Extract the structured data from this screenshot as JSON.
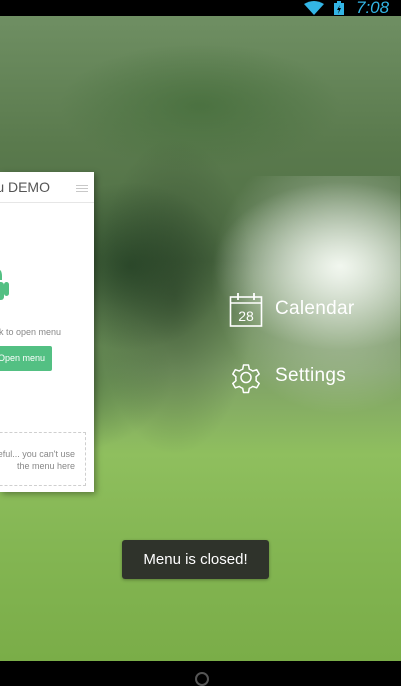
{
  "status_bar": {
    "time": "7:08",
    "icons": [
      "wifi-icon",
      "battery-icon"
    ]
  },
  "demo_card": {
    "title": "Menu DEMO",
    "hint": "Click to open menu",
    "open_button_label": "Open menu",
    "note_line1": "Be careful... you can't use",
    "note_line2": "the menu here",
    "accent_color": "#53c083",
    "icons": [
      "menu-lines-icon",
      "android-icon"
    ]
  },
  "side_menu": {
    "items": [
      {
        "label": "Calendar",
        "icon": "calendar-icon",
        "icon_text": "28"
      },
      {
        "label": "Settings",
        "icon": "gear-icon"
      }
    ]
  },
  "toast": {
    "text": "Menu is closed!"
  }
}
